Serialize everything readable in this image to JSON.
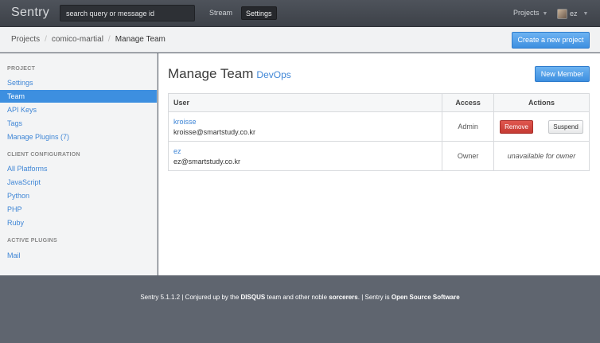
{
  "topbar": {
    "brand": "Sentry",
    "search_placeholder": "search query or message id",
    "nav": [
      "Stream",
      "Settings"
    ],
    "projects_label": "Projects",
    "user_label": "ez"
  },
  "breadcrumb": {
    "items": [
      "Projects",
      "comico-martial",
      "Manage Team"
    ],
    "separator": "/"
  },
  "create_project_label": "Create a new project",
  "sidebar": {
    "sections": [
      {
        "heading": "PROJECT",
        "items": [
          "Settings",
          "Team",
          "API Keys",
          "Tags",
          "Manage Plugins (7)"
        ]
      },
      {
        "heading": "CLIENT CONFIGURATION",
        "items": [
          "All Platforms",
          "JavaScript",
          "Python",
          "PHP",
          "Ruby"
        ]
      },
      {
        "heading": "ACTIVE PLUGINS",
        "items": [
          "Mail"
        ]
      }
    ],
    "active_item": "Team"
  },
  "main": {
    "title": "Manage Team",
    "team": "DevOps",
    "new_member_label": "New Member",
    "columns": [
      "User",
      "Access",
      "Actions"
    ],
    "rows": [
      {
        "name": "kroisse",
        "email": "kroisse@smartstudy.co.kr",
        "access": "Admin",
        "remove_label": "Remove",
        "suspend_label": "Suspend"
      },
      {
        "name": "ez",
        "email": "ez@smartstudy.co.kr",
        "access": "Owner",
        "actions_note": "unavailable for owner"
      }
    ]
  },
  "footer": {
    "version": "Sentry 5.1.1.2",
    "sep1": "|",
    "conjured": "Conjured up by the",
    "disqus": "DISQUS",
    "team_text": "team and other noble",
    "sorcerers": "sorcerers",
    "sep2": ". |",
    "sentry_is": "Sentry is",
    "oss": "Open Source Software"
  },
  "colors": {
    "accent": "#3d8fe0",
    "danger": "#c53a33",
    "topbar": "#45494f",
    "footer": "#5f656f"
  }
}
